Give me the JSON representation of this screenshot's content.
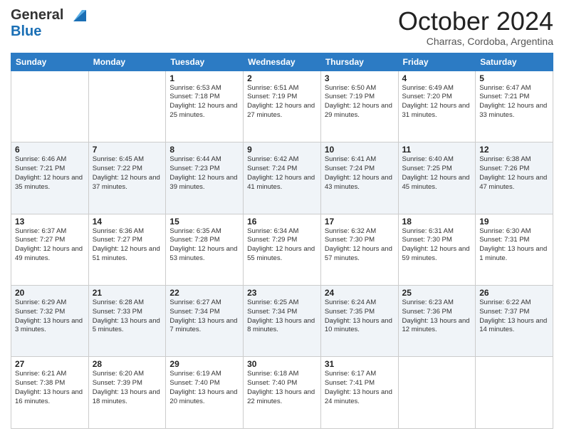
{
  "logo": {
    "line1": "General",
    "line2": "Blue"
  },
  "header": {
    "title": "October 2024",
    "location": "Charras, Cordoba, Argentina"
  },
  "days_of_week": [
    "Sunday",
    "Monday",
    "Tuesday",
    "Wednesday",
    "Thursday",
    "Friday",
    "Saturday"
  ],
  "weeks": [
    [
      {
        "day": "",
        "info": ""
      },
      {
        "day": "",
        "info": ""
      },
      {
        "day": "1",
        "info": "Sunrise: 6:53 AM\nSunset: 7:18 PM\nDaylight: 12 hours and 25 minutes."
      },
      {
        "day": "2",
        "info": "Sunrise: 6:51 AM\nSunset: 7:19 PM\nDaylight: 12 hours and 27 minutes."
      },
      {
        "day": "3",
        "info": "Sunrise: 6:50 AM\nSunset: 7:19 PM\nDaylight: 12 hours and 29 minutes."
      },
      {
        "day": "4",
        "info": "Sunrise: 6:49 AM\nSunset: 7:20 PM\nDaylight: 12 hours and 31 minutes."
      },
      {
        "day": "5",
        "info": "Sunrise: 6:47 AM\nSunset: 7:21 PM\nDaylight: 12 hours and 33 minutes."
      }
    ],
    [
      {
        "day": "6",
        "info": "Sunrise: 6:46 AM\nSunset: 7:21 PM\nDaylight: 12 hours and 35 minutes."
      },
      {
        "day": "7",
        "info": "Sunrise: 6:45 AM\nSunset: 7:22 PM\nDaylight: 12 hours and 37 minutes."
      },
      {
        "day": "8",
        "info": "Sunrise: 6:44 AM\nSunset: 7:23 PM\nDaylight: 12 hours and 39 minutes."
      },
      {
        "day": "9",
        "info": "Sunrise: 6:42 AM\nSunset: 7:24 PM\nDaylight: 12 hours and 41 minutes."
      },
      {
        "day": "10",
        "info": "Sunrise: 6:41 AM\nSunset: 7:24 PM\nDaylight: 12 hours and 43 minutes."
      },
      {
        "day": "11",
        "info": "Sunrise: 6:40 AM\nSunset: 7:25 PM\nDaylight: 12 hours and 45 minutes."
      },
      {
        "day": "12",
        "info": "Sunrise: 6:38 AM\nSunset: 7:26 PM\nDaylight: 12 hours and 47 minutes."
      }
    ],
    [
      {
        "day": "13",
        "info": "Sunrise: 6:37 AM\nSunset: 7:27 PM\nDaylight: 12 hours and 49 minutes."
      },
      {
        "day": "14",
        "info": "Sunrise: 6:36 AM\nSunset: 7:27 PM\nDaylight: 12 hours and 51 minutes."
      },
      {
        "day": "15",
        "info": "Sunrise: 6:35 AM\nSunset: 7:28 PM\nDaylight: 12 hours and 53 minutes."
      },
      {
        "day": "16",
        "info": "Sunrise: 6:34 AM\nSunset: 7:29 PM\nDaylight: 12 hours and 55 minutes."
      },
      {
        "day": "17",
        "info": "Sunrise: 6:32 AM\nSunset: 7:30 PM\nDaylight: 12 hours and 57 minutes."
      },
      {
        "day": "18",
        "info": "Sunrise: 6:31 AM\nSunset: 7:30 PM\nDaylight: 12 hours and 59 minutes."
      },
      {
        "day": "19",
        "info": "Sunrise: 6:30 AM\nSunset: 7:31 PM\nDaylight: 13 hours and 1 minute."
      }
    ],
    [
      {
        "day": "20",
        "info": "Sunrise: 6:29 AM\nSunset: 7:32 PM\nDaylight: 13 hours and 3 minutes."
      },
      {
        "day": "21",
        "info": "Sunrise: 6:28 AM\nSunset: 7:33 PM\nDaylight: 13 hours and 5 minutes."
      },
      {
        "day": "22",
        "info": "Sunrise: 6:27 AM\nSunset: 7:34 PM\nDaylight: 13 hours and 7 minutes."
      },
      {
        "day": "23",
        "info": "Sunrise: 6:25 AM\nSunset: 7:34 PM\nDaylight: 13 hours and 8 minutes."
      },
      {
        "day": "24",
        "info": "Sunrise: 6:24 AM\nSunset: 7:35 PM\nDaylight: 13 hours and 10 minutes."
      },
      {
        "day": "25",
        "info": "Sunrise: 6:23 AM\nSunset: 7:36 PM\nDaylight: 13 hours and 12 minutes."
      },
      {
        "day": "26",
        "info": "Sunrise: 6:22 AM\nSunset: 7:37 PM\nDaylight: 13 hours and 14 minutes."
      }
    ],
    [
      {
        "day": "27",
        "info": "Sunrise: 6:21 AM\nSunset: 7:38 PM\nDaylight: 13 hours and 16 minutes."
      },
      {
        "day": "28",
        "info": "Sunrise: 6:20 AM\nSunset: 7:39 PM\nDaylight: 13 hours and 18 minutes."
      },
      {
        "day": "29",
        "info": "Sunrise: 6:19 AM\nSunset: 7:40 PM\nDaylight: 13 hours and 20 minutes."
      },
      {
        "day": "30",
        "info": "Sunrise: 6:18 AM\nSunset: 7:40 PM\nDaylight: 13 hours and 22 minutes."
      },
      {
        "day": "31",
        "info": "Sunrise: 6:17 AM\nSunset: 7:41 PM\nDaylight: 13 hours and 24 minutes."
      },
      {
        "day": "",
        "info": ""
      },
      {
        "day": "",
        "info": ""
      }
    ]
  ]
}
